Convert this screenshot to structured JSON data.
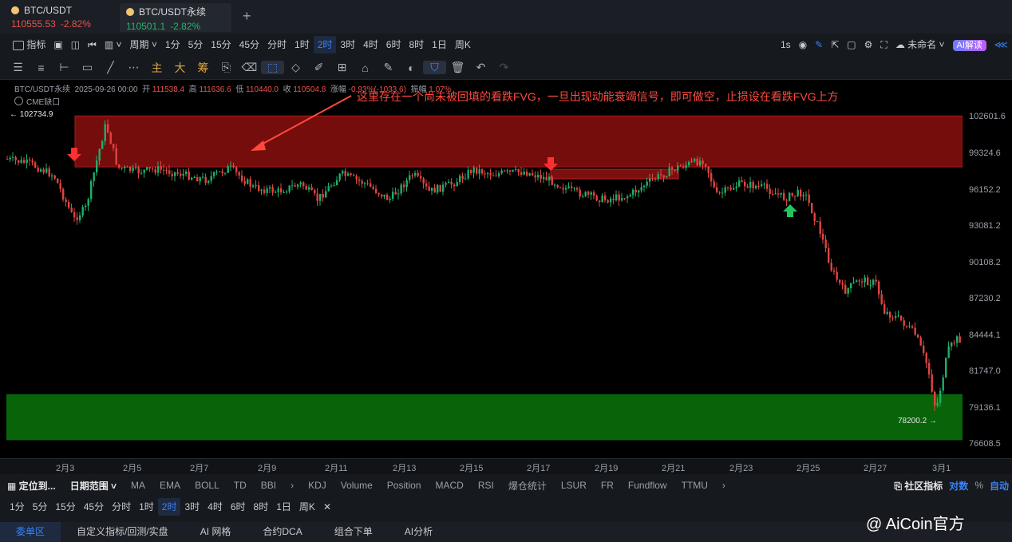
{
  "tabs": [
    {
      "symbol": "BTC/USDT",
      "price": "110555.53",
      "change": "-2.82%"
    },
    {
      "symbol": "BTC/USDT永续",
      "price": "110501.1",
      "change": "-2.82%"
    }
  ],
  "toolbar": {
    "indicators_label": "指标",
    "period_label": "周期",
    "periods": [
      "1分",
      "5分",
      "15分",
      "45分",
      "分时",
      "1时",
      "2时",
      "3时",
      "4时",
      "6时",
      "8时",
      "1日",
      "周K"
    ],
    "selected_period": "2时",
    "interval": "1s",
    "layout_name": "未命名",
    "ai_label": "AI解读"
  },
  "drawing_tools": {
    "main": "主",
    "big": "大",
    "chips": "筹"
  },
  "chart": {
    "header": {
      "symbol": "BTC/USDT永续",
      "datetime": "2025-09-26 00:00",
      "open_label": "开",
      "open": "111538.4",
      "high_label": "高",
      "high": "111636.6",
      "low_label": "低",
      "low": "110440.0",
      "close_label": "收",
      "close": "110504.8",
      "change_label": "涨幅",
      "change": "-0.93%(-1033.6)",
      "amplitude_label": "振幅",
      "amplitude": "1.07%"
    },
    "overlay_label": "CME缺口",
    "annotation": "这里存在一个尚未被回填的看跌FVG，一旦出现动能衰竭信号，即可做空，止损设在看跌FVG上方",
    "high_marker": "← 102734.9",
    "low_marker": "78200.2 →",
    "y_ticks": [
      "102601.6",
      "99324.6",
      "96152.2",
      "93081.2",
      "90108.2",
      "87230.2",
      "84444.1",
      "81747.0",
      "79136.1",
      "76608.5"
    ],
    "x_ticks": [
      "2月3",
      "2月5",
      "2月7",
      "2月9",
      "2月11",
      "2月13",
      "2月15",
      "2月17",
      "2月19",
      "2月21",
      "2月23",
      "2月25",
      "2月27",
      "3月1"
    ],
    "fvg_zone": {
      "top": 102650,
      "bottom": 98600,
      "color": "#8b1010"
    },
    "demand_zone": {
      "top": 80550,
      "bottom": 76900,
      "color": "#0a6e0a"
    }
  },
  "indicator_bar": {
    "locate_label": "定位到...",
    "range_label": "日期范围",
    "main_indicators": [
      "MA",
      "EMA",
      "BOLL",
      "TD",
      "BBI"
    ],
    "sub_indicators": [
      "KDJ",
      "Volume",
      "Position",
      "MACD",
      "RSI",
      "爆仓统计",
      "LSUR",
      "FR",
      "Fundflow",
      "TTMU"
    ],
    "community_label": "社区指标",
    "log_label": "对数",
    "percent_label": "%",
    "auto_label": "自动"
  },
  "bottom_tabs": [
    "委单区",
    "自定义指标/回测/实盘",
    "AI 网格",
    "合约DCA",
    "组合下单",
    "AI分析"
  ],
  "watermark": "@ AiCoin官方"
}
